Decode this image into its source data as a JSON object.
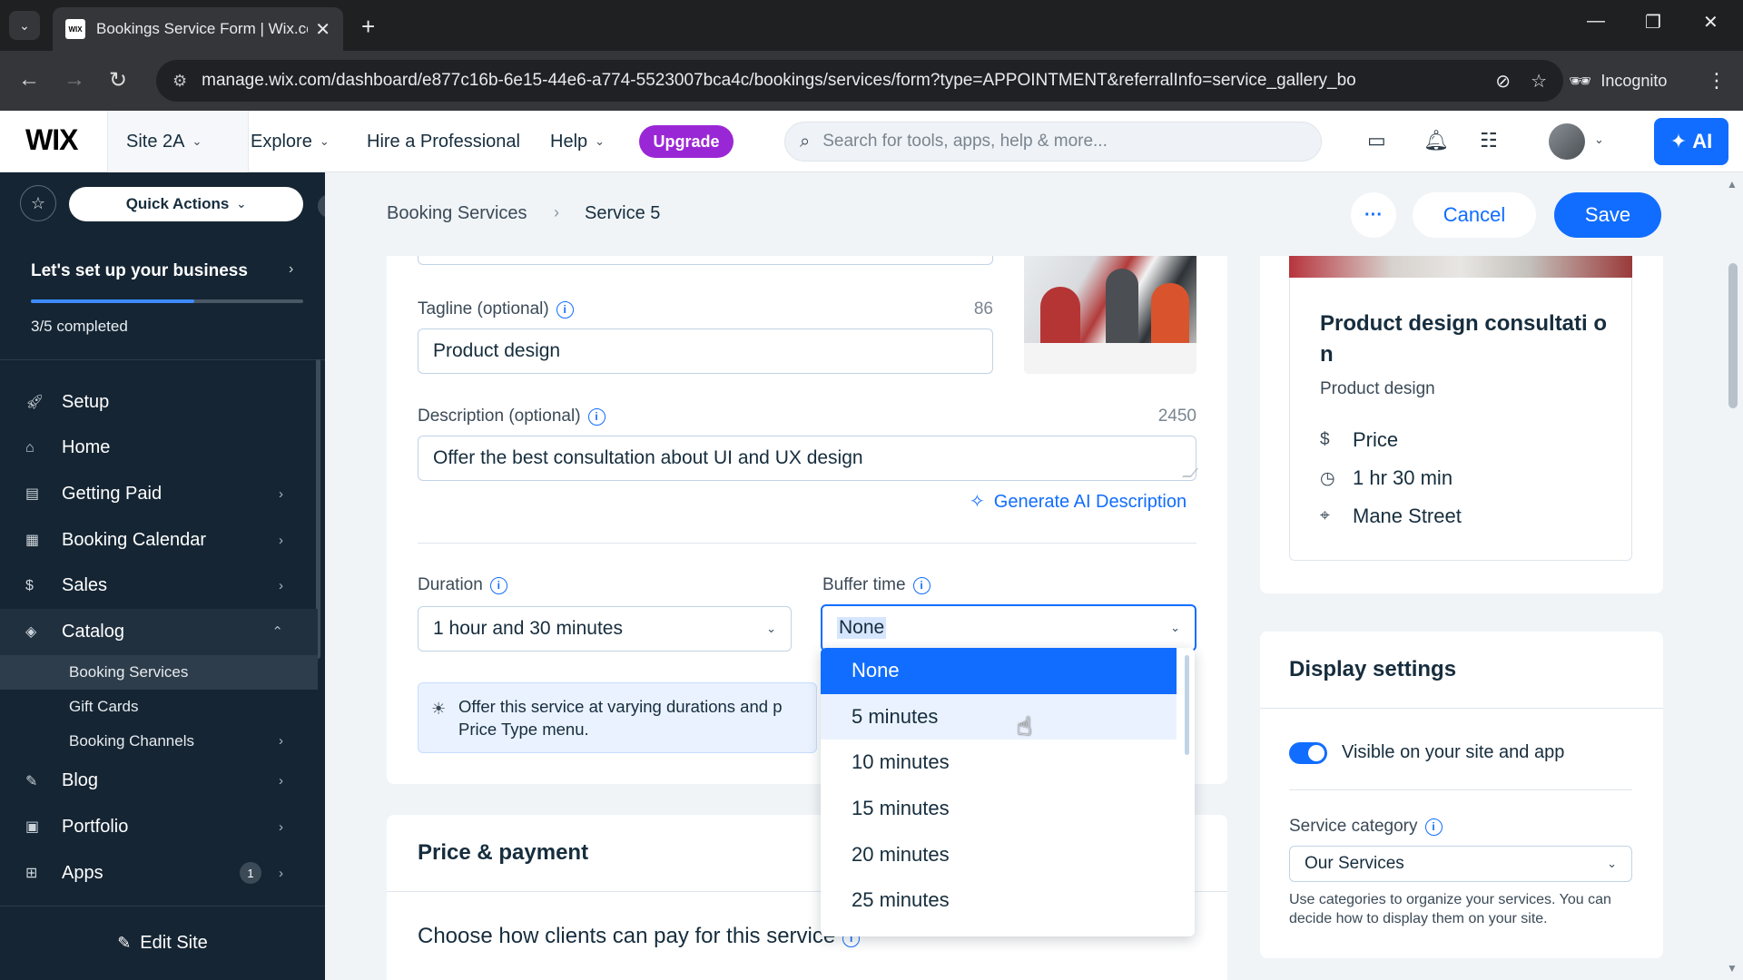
{
  "browser": {
    "tab_title": "Bookings Service Form | Wix.co",
    "favicon_text": "WIX",
    "url": "manage.wix.com/dashboard/e877c16b-6e15-44e6-a774-5523007bca4c/bookings/services/form?type=APPOINTMENT&referralInfo=service_gallery_bo",
    "incognito_label": "Incognito"
  },
  "topbar": {
    "logo": "WIX",
    "site_name": "Site 2A",
    "explore": "Explore",
    "hire": "Hire a Professional",
    "help": "Help",
    "upgrade": "Upgrade",
    "search_placeholder": "Search for tools, apps, help & more...",
    "ai_label": "AI"
  },
  "sidebar": {
    "quick_actions": "Quick Actions",
    "setup_title": "Let's set up your business",
    "setup_progress": 0.6,
    "setup_count": "3/5 completed",
    "items": [
      {
        "label": "Setup",
        "icon": "rocket-icon"
      },
      {
        "label": "Home",
        "icon": "home-icon"
      },
      {
        "label": "Getting Paid",
        "icon": "receipt-icon"
      },
      {
        "label": "Booking Calendar",
        "icon": "calendar-icon"
      },
      {
        "label": "Sales",
        "icon": "dollar-icon"
      },
      {
        "label": "Catalog",
        "icon": "tag-icon"
      }
    ],
    "catalog_sub": [
      "Booking Services",
      "Gift Cards",
      "Booking Channels"
    ],
    "items_after": [
      {
        "label": "Blog",
        "icon": "pen-icon"
      },
      {
        "label": "Portfolio",
        "icon": "portfolio-icon"
      },
      {
        "label": "Apps",
        "icon": "apps-icon",
        "badge": "1"
      }
    ],
    "edit_site": "Edit Site"
  },
  "header": {
    "breadcrumb_root": "Booking Services",
    "breadcrumb_current": "Service 5",
    "more_label": "···",
    "cancel": "Cancel",
    "save": "Save"
  },
  "form": {
    "tagline_label": "Tagline (optional)",
    "tagline_count": "86",
    "tagline_value": "Product design",
    "description_label": "Description (optional)",
    "description_count": "2450",
    "description_value": "Offer the best consultation about UI and UX design",
    "generate_ai": "Generate AI Description",
    "duration_label": "Duration",
    "duration_value": "1 hour and 30 minutes",
    "buffer_label": "Buffer time",
    "buffer_value": "None",
    "tip_text": "Offer this service at varying durations and p... Price Type menu.",
    "tip_line1": "Offer this service at varying durations and p",
    "tip_line2": "Price Type menu."
  },
  "buffer_dropdown": {
    "options": [
      "None",
      "5 minutes",
      "10 minutes",
      "15 minutes",
      "20 minutes",
      "25 minutes"
    ],
    "selected": "None",
    "hovered": "5 minutes"
  },
  "price": {
    "title": "Price & payment",
    "question": "Choose how clients can pay for this service"
  },
  "preview": {
    "title": "Product design consultati on",
    "subtitle": "Product design",
    "price_label": "Price",
    "duration": "1 hr 30 min",
    "location": "Mane Street"
  },
  "display_settings": {
    "title": "Display settings",
    "visible_label": "Visible on your site and app",
    "visible_on": true,
    "category_label": "Service category",
    "category_value": "Our Services",
    "category_help": "Use categories to organize your services. You can decide how to display them on your site."
  },
  "colors": {
    "primary": "#116dff",
    "upgrade": "#9a27d5",
    "sidebar_bg": "#152533"
  }
}
